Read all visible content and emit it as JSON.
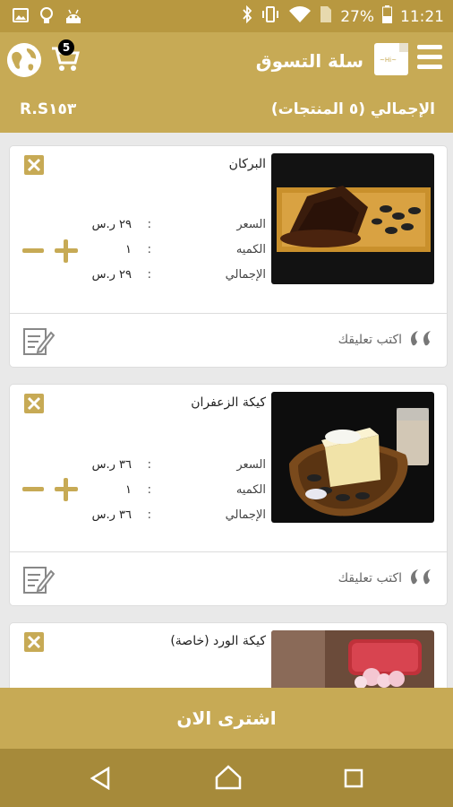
{
  "status_bar": {
    "battery": "27%",
    "time": "11:21"
  },
  "header": {
    "title": "سلة التسوق",
    "cart_count": "5",
    "logo_text": "~Hi~"
  },
  "summary": {
    "label": "الإجمالي (٥ المنتجات)",
    "total": "R.S١٥٣"
  },
  "labels": {
    "price": "السعر",
    "quantity": "الكميه",
    "total": "الإجمالي",
    "colon": ":",
    "write_comment": "اكتب تعليقك"
  },
  "items": [
    {
      "name": "البركان",
      "price": "٢٩ ر.س",
      "quantity": "١",
      "total": "٢٩ ر.س"
    },
    {
      "name": "كيكة الزعفران",
      "price": "٣٦ ر.س",
      "quantity": "١",
      "total": "٣٦ ر.س"
    },
    {
      "name": "كيكة الورد (خاصة)"
    }
  ],
  "buy_now": "اشترى الان",
  "colors": {
    "accent": "#c7aa55",
    "status_bar": "#b89840",
    "nav_bar": "#a68a3a"
  },
  "icons": [
    "gallery-icon",
    "bulb-icon",
    "android-icon",
    "bluetooth-icon",
    "vibrate-icon",
    "wifi-icon",
    "sim-icon",
    "battery-icon",
    "menu-icon",
    "globe-icon",
    "cart-icon",
    "close-icon",
    "plus-icon",
    "minus-icon",
    "edit-icon",
    "quote-icon",
    "back-icon",
    "home-icon",
    "recent-apps-icon"
  ]
}
